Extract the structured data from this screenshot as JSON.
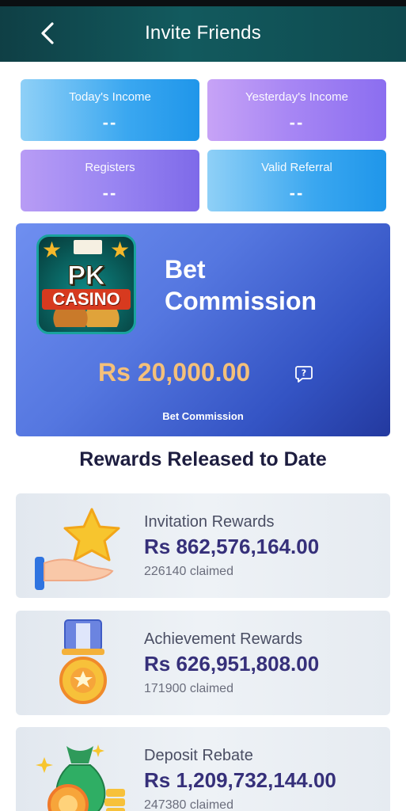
{
  "header": {
    "title": "Invite Friends"
  },
  "stats": [
    {
      "label": "Today's Income",
      "value": "--"
    },
    {
      "label": "Yesterday's Income",
      "value": "--"
    },
    {
      "label": "Registers",
      "value": "--"
    },
    {
      "label": "Valid Referral",
      "value": "--"
    }
  ],
  "bet_card": {
    "logo_top": "PK",
    "logo_bottom": "CASINO",
    "heading_line1": "Bet",
    "heading_line2": "Commission",
    "amount": "Rs 20,000.00",
    "caption": "Bet Commission",
    "help_icon": "question-bubble-icon"
  },
  "rewards": {
    "title": "Rewards Released to Date",
    "items": [
      {
        "name": "Invitation Rewards",
        "amount": "Rs 862,576,164.00",
        "claimed": "226140 claimed",
        "icon": "hand-star-icon"
      },
      {
        "name": "Achievement Rewards",
        "amount": "Rs 626,951,808.00",
        "claimed": "171900 claimed",
        "icon": "medal-icon"
      },
      {
        "name": "Deposit Rebate",
        "amount": "Rs 1,209,732,144.00",
        "claimed": "247380 claimed",
        "icon": "money-bag-icon"
      }
    ]
  },
  "colors": {
    "header": "#125a5e",
    "amount_gold": "#f4c07a",
    "reward_amount": "#36307a"
  }
}
